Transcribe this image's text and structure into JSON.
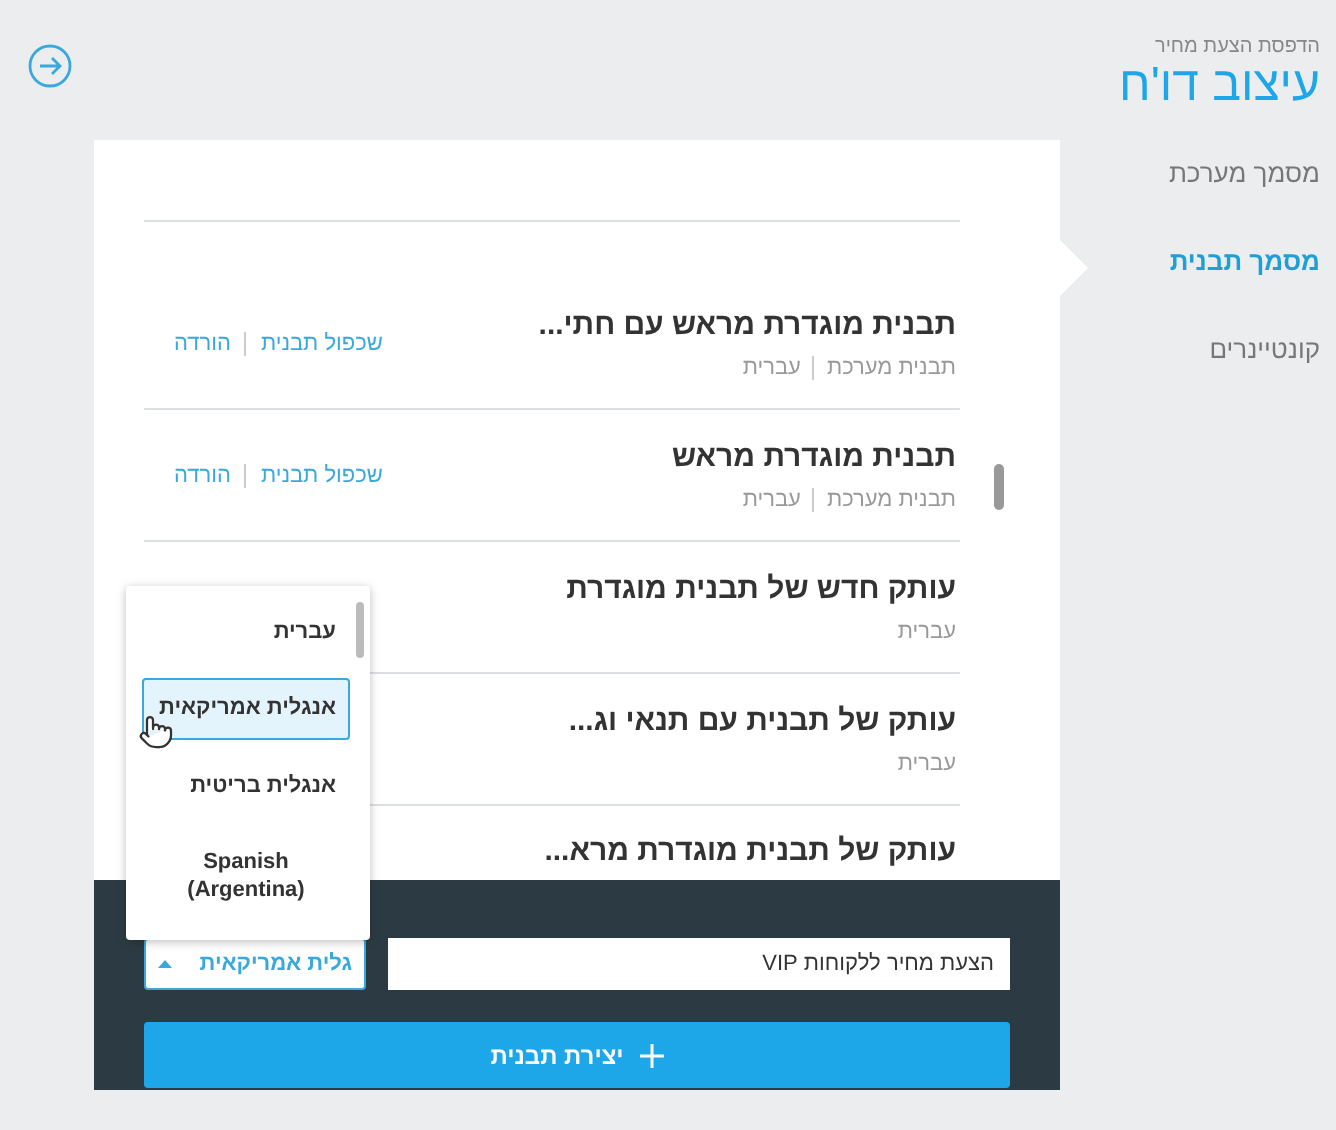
{
  "sidebar": {
    "subtitle": "הדפסת הצעת מחיר",
    "title": "עיצוב דו'ח",
    "items": [
      {
        "label": "מסמך מערכת",
        "selected": false
      },
      {
        "label": "מסמך תבנית",
        "selected": true
      },
      {
        "label": "קונטיינרים",
        "selected": false
      }
    ]
  },
  "templates": [
    {
      "title": "תבנית מוגדרת מראש עם חתי...",
      "meta": [
        "תבנית מערכת",
        "עברית"
      ],
      "actions": [
        "שכפול תבנית",
        "הורדה"
      ]
    },
    {
      "title": "תבנית מוגדרת מראש",
      "meta": [
        "תבנית מערכת",
        "עברית"
      ],
      "actions": [
        "שכפול תבנית",
        "הורדה"
      ]
    },
    {
      "title": "עותק חדש של תבנית מוגדרת",
      "meta": [
        "עברית"
      ]
    },
    {
      "title": "עותק של תבנית עם תנאי וג...",
      "meta": [
        "עברית"
      ]
    },
    {
      "title": "עותק של תבנית מוגדרת מרא..."
    }
  ],
  "language_dropdown": {
    "value": "גלית אמריקאית",
    "expanded": true,
    "options": [
      {
        "label": "עברית",
        "selected": false
      },
      {
        "label": "אנגלית אמריקאית",
        "selected": true
      },
      {
        "label": "אנגלית בריטית",
        "selected": false
      },
      {
        "label": "Spanish (Argentina)",
        "selected": false
      }
    ]
  },
  "name_field": {
    "value": "הצעת מחיר ללקוחות VIP"
  },
  "create_button": {
    "label": "יצירת תבנית"
  }
}
